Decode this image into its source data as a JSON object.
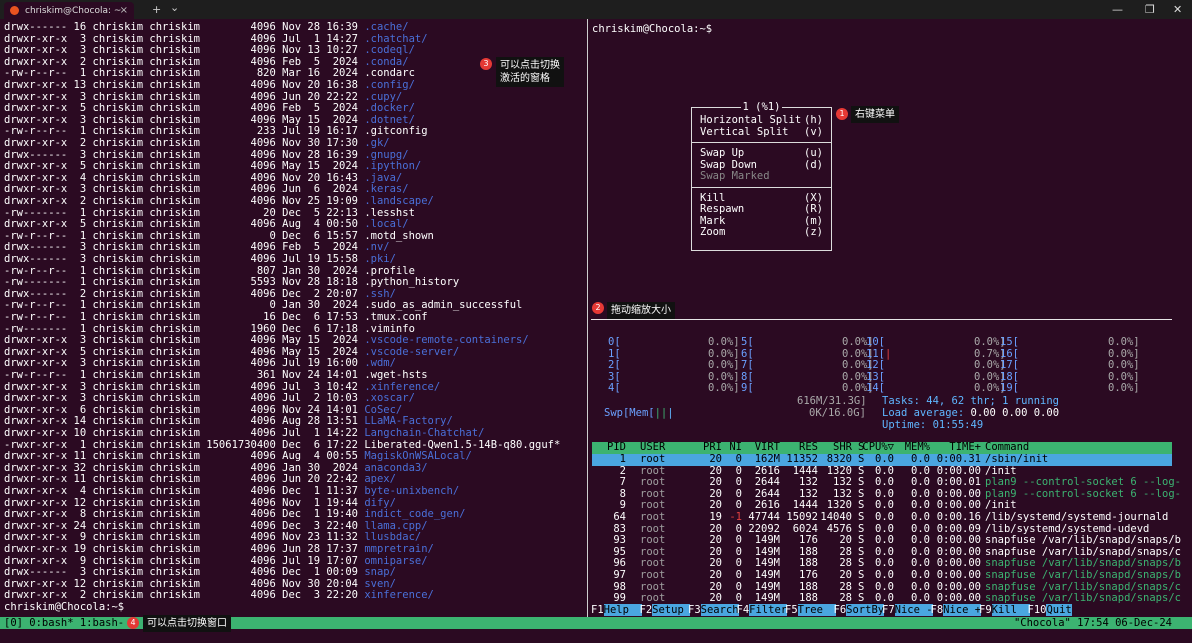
{
  "window": {
    "tab_title": "chriskim@Chocola: ~",
    "tab_close": "×",
    "new_tab": "+",
    "tab_dropdown": "⌄",
    "minimize": "—",
    "maximize": "❐",
    "close": "✕"
  },
  "left_pane": {
    "lines": [
      {
        "perm": "drwx------",
        "links": "16",
        "user": "chriskim",
        "group": "chriskim",
        "size": "4096",
        "date": "Nov 28 16:39",
        "name": ".cache/",
        "dir": true
      },
      {
        "perm": "drwxr-xr-x",
        "links": "3",
        "user": "chriskim",
        "group": "chriskim",
        "size": "4096",
        "date": "Jul  1 14:27",
        "name": ".chatchat/",
        "dir": true
      },
      {
        "perm": "drwxr-xr-x",
        "links": "3",
        "user": "chriskim",
        "group": "chriskim",
        "size": "4096",
        "date": "Nov 13 10:27",
        "name": ".codeql/",
        "dir": true
      },
      {
        "perm": "drwxr-xr-x",
        "links": "2",
        "user": "chriskim",
        "group": "chriskim",
        "size": "4096",
        "date": "Feb  5  2024",
        "name": ".conda/",
        "dir": true
      },
      {
        "perm": "-rw-r--r--",
        "links": "1",
        "user": "chriskim",
        "group": "chriskim",
        "size": "820",
        "date": "Mar 16  2024",
        "name": ".condarc",
        "dir": false
      },
      {
        "perm": "drwxr-xr-x",
        "links": "13",
        "user": "chriskim",
        "group": "chriskim",
        "size": "4096",
        "date": "Nov 20 16:38",
        "name": ".config/",
        "dir": true
      },
      {
        "perm": "drwxr-xr-x",
        "links": "3",
        "user": "chriskim",
        "group": "chriskim",
        "size": "4096",
        "date": "Jun 20 22:22",
        "name": ".cupy/",
        "dir": true
      },
      {
        "perm": "drwxr-xr-x",
        "links": "5",
        "user": "chriskim",
        "group": "chriskim",
        "size": "4096",
        "date": "Feb  5  2024",
        "name": ".docker/",
        "dir": true
      },
      {
        "perm": "drwxr-xr-x",
        "links": "3",
        "user": "chriskim",
        "group": "chriskim",
        "size": "4096",
        "date": "May 15  2024",
        "name": ".dotnet/",
        "dir": true
      },
      {
        "perm": "-rw-r--r--",
        "links": "1",
        "user": "chriskim",
        "group": "chriskim",
        "size": "233",
        "date": "Jul 19 16:17",
        "name": ".gitconfig",
        "dir": false
      },
      {
        "perm": "drwxr-xr-x",
        "links": "2",
        "user": "chriskim",
        "group": "chriskim",
        "size": "4096",
        "date": "Nov 30 17:30",
        "name": ".gk/",
        "dir": true
      },
      {
        "perm": "drwx------",
        "links": "3",
        "user": "chriskim",
        "group": "chriskim",
        "size": "4096",
        "date": "Nov 28 16:39",
        "name": ".gnupg/",
        "dir": true
      },
      {
        "perm": "drwxr-xr-x",
        "links": "5",
        "user": "chriskim",
        "group": "chriskim",
        "size": "4096",
        "date": "May 15  2024",
        "name": ".ipython/",
        "dir": true
      },
      {
        "perm": "drwxr-xr-x",
        "links": "4",
        "user": "chriskim",
        "group": "chriskim",
        "size": "4096",
        "date": "Nov 20 16:43",
        "name": ".java/",
        "dir": true
      },
      {
        "perm": "drwxr-xr-x",
        "links": "3",
        "user": "chriskim",
        "group": "chriskim",
        "size": "4096",
        "date": "Jun  6  2024",
        "name": ".keras/",
        "dir": true
      },
      {
        "perm": "drwxr-xr-x",
        "links": "2",
        "user": "chriskim",
        "group": "chriskim",
        "size": "4096",
        "date": "Nov 25 19:09",
        "name": ".landscape/",
        "dir": true
      },
      {
        "perm": "-rw-------",
        "links": "1",
        "user": "chriskim",
        "group": "chriskim",
        "size": "20",
        "date": "Dec  5 22:13",
        "name": ".lesshst",
        "dir": false
      },
      {
        "perm": "drwxr-xr-x",
        "links": "5",
        "user": "chriskim",
        "group": "chriskim",
        "size": "4096",
        "date": "Aug  4 00:50",
        "name": ".local/",
        "dir": true
      },
      {
        "perm": "-rw-r--r--",
        "links": "1",
        "user": "chriskim",
        "group": "chriskim",
        "size": "0",
        "date": "Dec  6 15:57",
        "name": ".motd_shown",
        "dir": false
      },
      {
        "perm": "drwx------",
        "links": "3",
        "user": "chriskim",
        "group": "chriskim",
        "size": "4096",
        "date": "Feb  5  2024",
        "name": ".nv/",
        "dir": true
      },
      {
        "perm": "drwx------",
        "links": "3",
        "user": "chriskim",
        "group": "chriskim",
        "size": "4096",
        "date": "Jul 19 15:58",
        "name": ".pki/",
        "dir": true
      },
      {
        "perm": "-rw-r--r--",
        "links": "1",
        "user": "chriskim",
        "group": "chriskim",
        "size": "807",
        "date": "Jan 30  2024",
        "name": ".profile",
        "dir": false
      },
      {
        "perm": "-rw-------",
        "links": "1",
        "user": "chriskim",
        "group": "chriskim",
        "size": "5593",
        "date": "Nov 28 18:18",
        "name": ".python_history",
        "dir": false
      },
      {
        "perm": "drwx------",
        "links": "2",
        "user": "chriskim",
        "group": "chriskim",
        "size": "4096",
        "date": "Dec  2 20:07",
        "name": ".ssh/",
        "dir": true
      },
      {
        "perm": "-rw-r--r--",
        "links": "1",
        "user": "chriskim",
        "group": "chriskim",
        "size": "0",
        "date": "Jan 30  2024",
        "name": ".sudo_as_admin_successful",
        "dir": false
      },
      {
        "perm": "-rw-r--r--",
        "links": "1",
        "user": "chriskim",
        "group": "chriskim",
        "size": "16",
        "date": "Dec  6 17:53",
        "name": ".tmux.conf",
        "dir": false
      },
      {
        "perm": "-rw-------",
        "links": "1",
        "user": "chriskim",
        "group": "chriskim",
        "size": "1960",
        "date": "Dec  6 17:18",
        "name": ".viminfo",
        "dir": false
      },
      {
        "perm": "drwxr-xr-x",
        "links": "3",
        "user": "chriskim",
        "group": "chriskim",
        "size": "4096",
        "date": "May 15  2024",
        "name": ".vscode-remote-containers/",
        "dir": true
      },
      {
        "perm": "drwxr-xr-x",
        "links": "5",
        "user": "chriskim",
        "group": "chriskim",
        "size": "4096",
        "date": "May 15  2024",
        "name": ".vscode-server/",
        "dir": true
      },
      {
        "perm": "drwxr-xr-x",
        "links": "3",
        "user": "chriskim",
        "group": "chriskim",
        "size": "4096",
        "date": "Jul 19 16:00",
        "name": ".wdm/",
        "dir": true
      },
      {
        "perm": "-rw-r--r--",
        "links": "1",
        "user": "chriskim",
        "group": "chriskim",
        "size": "361",
        "date": "Nov 24 14:01",
        "name": ".wget-hsts",
        "dir": false
      },
      {
        "perm": "drwxr-xr-x",
        "links": "3",
        "user": "chriskim",
        "group": "chriskim",
        "size": "4096",
        "date": "Jul  3 10:42",
        "name": ".xinference/",
        "dir": true
      },
      {
        "perm": "drwxr-xr-x",
        "links": "3",
        "user": "chriskim",
        "group": "chriskim",
        "size": "4096",
        "date": "Jul  2 10:03",
        "name": ".xoscar/",
        "dir": true
      },
      {
        "perm": "drwxr-xr-x",
        "links": "6",
        "user": "chriskim",
        "group": "chriskim",
        "size": "4096",
        "date": "Nov 24 14:01",
        "name": "CoSec/",
        "dir": true
      },
      {
        "perm": "drwxr-xr-x",
        "links": "14",
        "user": "chriskim",
        "group": "chriskim",
        "size": "4096",
        "date": "Aug 28 13:51",
        "name": "LLaMA-Factory/",
        "dir": true
      },
      {
        "perm": "drwxr-xr-x",
        "links": "10",
        "user": "chriskim",
        "group": "chriskim",
        "size": "4096",
        "date": "Jul  1 14:22",
        "name": "Langchain-Chatchat/",
        "dir": true
      },
      {
        "perm": "-rwxr-xr-x",
        "links": "1",
        "user": "chriskim",
        "group": "chriskim",
        "size": "15061730400",
        "date": "Dec  6 17:22",
        "name": "Liberated-Qwen1.5-14B-q80.gguf*",
        "dir": false
      },
      {
        "perm": "drwxr-xr-x",
        "links": "11",
        "user": "chriskim",
        "group": "chriskim",
        "size": "4096",
        "date": "Aug  4 00:55",
        "name": "MagiskOnWSALocal/",
        "dir": true
      },
      {
        "perm": "drwxr-xr-x",
        "links": "32",
        "user": "chriskim",
        "group": "chriskim",
        "size": "4096",
        "date": "Jan 30  2024",
        "name": "anaconda3/",
        "dir": true
      },
      {
        "perm": "drwxr-xr-x",
        "links": "11",
        "user": "chriskim",
        "group": "chriskim",
        "size": "4096",
        "date": "Jun 20 22:42",
        "name": "apex/",
        "dir": true
      },
      {
        "perm": "drwxr-xr-x",
        "links": "4",
        "user": "chriskim",
        "group": "chriskim",
        "size": "4096",
        "date": "Dec  1 11:37",
        "name": "byte-unixbench/",
        "dir": true
      },
      {
        "perm": "drwxr-xr-x",
        "links": "12",
        "user": "chriskim",
        "group": "chriskim",
        "size": "4096",
        "date": "Nov  1 19:44",
        "name": "dify/",
        "dir": true
      },
      {
        "perm": "drwxr-xr-x",
        "links": "8",
        "user": "chriskim",
        "group": "chriskim",
        "size": "4096",
        "date": "Dec  1 19:40",
        "name": "indict_code_gen/",
        "dir": true
      },
      {
        "perm": "drwxr-xr-x",
        "links": "24",
        "user": "chriskim",
        "group": "chriskim",
        "size": "4096",
        "date": "Dec  3 22:40",
        "name": "llama.cpp/",
        "dir": true
      },
      {
        "perm": "drwxr-xr-x",
        "links": "9",
        "user": "chriskim",
        "group": "chriskim",
        "size": "4096",
        "date": "Nov 23 11:32",
        "name": "llusbdac/",
        "dir": true
      },
      {
        "perm": "drwxr-xr-x",
        "links": "19",
        "user": "chriskim",
        "group": "chriskim",
        "size": "4096",
        "date": "Jun 28 17:37",
        "name": "mmpretrain/",
        "dir": true
      },
      {
        "perm": "drwxr-xr-x",
        "links": "9",
        "user": "chriskim",
        "group": "chriskim",
        "size": "4096",
        "date": "Jul 19 17:07",
        "name": "omniparse/",
        "dir": true
      },
      {
        "perm": "drwx------",
        "links": "3",
        "user": "chriskim",
        "group": "chriskim",
        "size": "4096",
        "date": "Dec  1 00:09",
        "name": "snap/",
        "dir": true
      },
      {
        "perm": "drwxr-xr-x",
        "links": "12",
        "user": "chriskim",
        "group": "chriskim",
        "size": "4096",
        "date": "Nov 30 20:04",
        "name": "sven/",
        "dir": true
      },
      {
        "perm": "drwxr-xr-x",
        "links": "2",
        "user": "chriskim",
        "group": "chriskim",
        "size": "4096",
        "date": "Dec  3 22:20",
        "name": "xinference/",
        "dir": true
      }
    ],
    "prompt": "chriskim@Chocola:~$"
  },
  "right_pane": {
    "prompt": "chriskim@Chocola:~$",
    "context_menu": {
      "title": "1 (%1)",
      "items": [
        {
          "label": "Horizontal Split",
          "key": "(h)",
          "enabled": true,
          "group": 1
        },
        {
          "label": "Vertical Split",
          "key": "(v)",
          "enabled": true,
          "group": 1
        },
        {
          "label": "Swap Up",
          "key": "(u)",
          "enabled": true,
          "group": 2
        },
        {
          "label": "Swap Down",
          "key": "(d)",
          "enabled": true,
          "group": 2
        },
        {
          "label": "Swap Marked",
          "key": "",
          "enabled": false,
          "group": 2
        },
        {
          "label": "Kill",
          "key": "(X)",
          "enabled": true,
          "group": 3
        },
        {
          "label": "Respawn",
          "key": "(R)",
          "enabled": true,
          "group": 3
        },
        {
          "label": "Mark",
          "key": "(m)",
          "enabled": true,
          "group": 3
        },
        {
          "label": "Zoom",
          "key": "(z)",
          "enabled": true,
          "group": 3
        }
      ]
    },
    "htop": {
      "cpus": [
        {
          "n": "0",
          "v": "0.0%]"
        },
        {
          "n": "1",
          "v": "0.0%]"
        },
        {
          "n": "2",
          "v": "0.0%]"
        },
        {
          "n": "3",
          "v": "0.0%]"
        },
        {
          "n": "4",
          "v": "0.0%]"
        },
        {
          "n": "5",
          "v": "0.0%]"
        },
        {
          "n": "6",
          "v": "0.0%]"
        },
        {
          "n": "7",
          "v": "0.0%]"
        },
        {
          "n": "8",
          "v": "0.0%]"
        },
        {
          "n": "9",
          "v": "0.0%]"
        },
        {
          "n": "10",
          "v": "0.0%]"
        },
        {
          "n": "11",
          "v": "0.7%]"
        },
        {
          "n": "12",
          "v": "0.0%]"
        },
        {
          "n": "13",
          "v": "0.0%]"
        },
        {
          "n": "14",
          "v": "0.0%]"
        },
        {
          "n": "15",
          "v": "0.0%]"
        },
        {
          "n": "16",
          "v": "0.0%]"
        },
        {
          "n": "17",
          "v": "0.0%]"
        },
        {
          "n": "18",
          "v": "0.0%]"
        },
        {
          "n": "19",
          "v": "0.0%]"
        }
      ],
      "mem_label": "Mem[",
      "mem_value": "616M/31.3G]",
      "swp_label": "Swp[",
      "swp_value": "0K/16.0G]",
      "tasks": "Tasks: 44, 62 thr; 1 running",
      "load_label": "Load average:",
      "load_values": "0.00 0.00 0.00",
      "uptime": "Uptime: 01:55:49",
      "header": [
        "PID",
        "USER",
        "PRI",
        "NI",
        "VIRT",
        "RES",
        "SHR",
        "S",
        "CPU%▽",
        "MEM%",
        "TIME+",
        "Command"
      ],
      "rows": [
        [
          "1",
          "root",
          "20",
          "0",
          "162M",
          "11352",
          "8320",
          "S",
          "0.0",
          "0.0",
          "0:00.31",
          "/sbin/init"
        ],
        [
          "2",
          "root",
          "20",
          "0",
          "2616",
          "1444",
          "1320",
          "S",
          "0.0",
          "0.0",
          "0:00.00",
          "/init"
        ],
        [
          "7",
          "root",
          "20",
          "0",
          "2644",
          "132",
          "132",
          "S",
          "0.0",
          "0.0",
          "0:00.01",
          "plan9 --control-socket 6 --log-"
        ],
        [
          "8",
          "root",
          "20",
          "0",
          "2644",
          "132",
          "132",
          "S",
          "0.0",
          "0.0",
          "0:00.00",
          "plan9 --control-socket 6 --log-"
        ],
        [
          "9",
          "root",
          "20",
          "0",
          "2616",
          "1444",
          "1320",
          "S",
          "0.0",
          "0.0",
          "0:00.00",
          "/init"
        ],
        [
          "64",
          "root",
          "19",
          "-1",
          "47744",
          "15092",
          "14040",
          "S",
          "0.0",
          "0.0",
          "0:00.16",
          "/lib/systemd/systemd-journald"
        ],
        [
          "83",
          "root",
          "20",
          "0",
          "22092",
          "6024",
          "4576",
          "S",
          "0.0",
          "0.0",
          "0:00.09",
          "/lib/systemd/systemd-udevd"
        ],
        [
          "93",
          "root",
          "20",
          "0",
          "149M",
          "176",
          "20",
          "S",
          "0.0",
          "0.0",
          "0:00.00",
          "snapfuse /var/lib/snapd/snaps/b"
        ],
        [
          "95",
          "root",
          "20",
          "0",
          "149M",
          "188",
          "28",
          "S",
          "0.0",
          "0.0",
          "0:00.00",
          "snapfuse /var/lib/snapd/snaps/c"
        ],
        [
          "96",
          "root",
          "20",
          "0",
          "149M",
          "188",
          "28",
          "S",
          "0.0",
          "0.0",
          "0:00.00",
          "snapfuse /var/lib/snapd/snaps/b"
        ],
        [
          "97",
          "root",
          "20",
          "0",
          "149M",
          "176",
          "20",
          "S",
          "0.0",
          "0.0",
          "0:00.00",
          "snapfuse /var/lib/snapd/snaps/b"
        ],
        [
          "98",
          "root",
          "20",
          "0",
          "149M",
          "188",
          "28",
          "S",
          "0.0",
          "0.0",
          "0:00.00",
          "snapfuse /var/lib/snapd/snaps/c"
        ],
        [
          "99",
          "root",
          "20",
          "0",
          "149M",
          "188",
          "28",
          "S",
          "0.0",
          "0.0",
          "0:00.00",
          "snapfuse /var/lib/snapd/snaps/c"
        ]
      ],
      "fkeys": [
        {
          "k": "F1",
          "l": "Help  "
        },
        {
          "k": "F2",
          "l": "Setup "
        },
        {
          "k": "F3",
          "l": "Search"
        },
        {
          "k": "F4",
          "l": "Filter"
        },
        {
          "k": "F5",
          "l": "Tree  "
        },
        {
          "k": "F6",
          "l": "SortBy"
        },
        {
          "k": "F7",
          "l": "Nice -"
        },
        {
          "k": "F8",
          "l": "Nice +"
        },
        {
          "k": "F9",
          "l": "Kill  "
        },
        {
          "k": "F10",
          "l": "Quit"
        }
      ]
    }
  },
  "status_bar": {
    "left": "[0] 0:bash* 1:bash-",
    "right": "\"Chocola\" 17:54 06-Dec-24"
  },
  "annotations": [
    {
      "n": "1",
      "text": "右键菜单"
    },
    {
      "n": "2",
      "text": "拖动缩放大小"
    },
    {
      "n": "3",
      "text": "可以点击切换\n激活的窗格"
    },
    {
      "n": "4",
      "text": "可以点击切换窗口"
    }
  ],
  "colors": {
    "background": "#2b0a22",
    "directory": "#4a6fd8",
    "status_bar": "#3cb371",
    "selected_row": "#4aa6e0",
    "annotation_dot": "#e53935"
  }
}
